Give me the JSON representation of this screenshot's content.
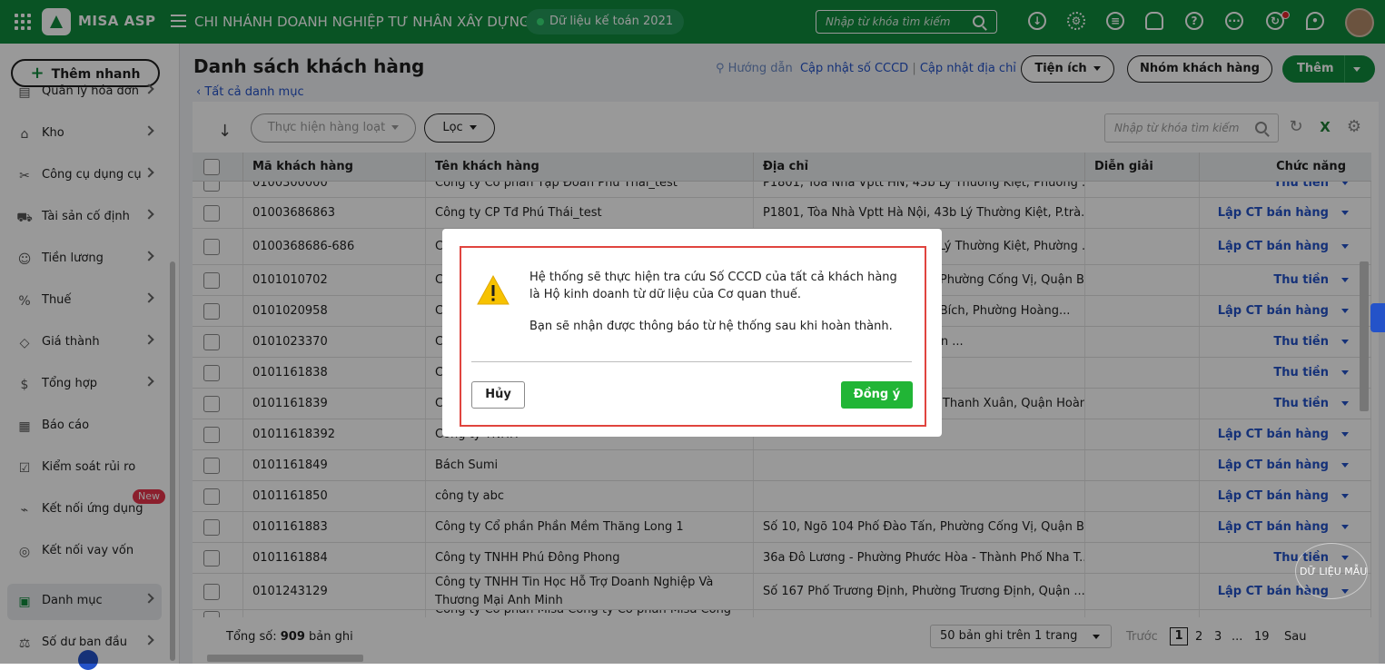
{
  "topbar": {
    "brand": "MISA ASP",
    "company": "CHI NHÁNH DOANH NGHIỆP TƯ NHÂN XÂY DỰNG ...",
    "database": "Dữ liệu kế toán 2021",
    "search_placeholder": "Nhập từ khóa tìm kiếm",
    "icons": [
      "download-icon",
      "gear-icon",
      "chat-icon",
      "bell-icon",
      "help-icon",
      "more-icon",
      "refresh-notify-icon",
      "location-icon"
    ]
  },
  "sidebar": {
    "quick_add": "Thêm nhanh",
    "items": [
      {
        "label": "Quản lý hóa đơn",
        "icon": "invoice-icon"
      },
      {
        "label": "Kho",
        "icon": "warehouse-icon"
      },
      {
        "label": "Công cụ dụng cụ",
        "icon": "tools-icon"
      },
      {
        "label": "Tài sản cố định",
        "icon": "asset-icon"
      },
      {
        "label": "Tiền lương",
        "icon": "salary-icon"
      },
      {
        "label": "Thuế",
        "icon": "tax-icon"
      },
      {
        "label": "Giá thành",
        "icon": "price-tag-icon"
      },
      {
        "label": "Tổng hợp",
        "icon": "summary-icon"
      },
      {
        "label": "Báo cáo",
        "icon": "report-icon"
      },
      {
        "label": "Kiểm soát rủi ro",
        "icon": "risk-icon"
      },
      {
        "label": "Kết nối ứng dụng",
        "icon": "plug-icon"
      },
      {
        "label": "Kết nối vay vốn",
        "icon": "loan-icon"
      },
      {
        "label": "Danh mục",
        "icon": "catalog-icon"
      },
      {
        "label": "Số dư ban đầu",
        "icon": "balance-icon"
      }
    ],
    "new_badge": "New"
  },
  "header": {
    "title": "Danh sách khách hàng",
    "back": "Tất cả danh mục",
    "guide": "Hướng dẫn",
    "update_cccd": "Cập nhật số CCCD",
    "update_address": "Cập nhật địa chỉ",
    "separator": "|",
    "utilities": "Tiện ích",
    "customer_group": "Nhóm khách hàng",
    "add": "Thêm"
  },
  "grid": {
    "batch": "Thực hiện hàng loạt",
    "filter": "Lọc",
    "search_placeholder": "Nhập từ khóa tìm kiếm",
    "columns": [
      "Mã khách hàng",
      "Tên khách hàng",
      "Địa chỉ",
      "Diễn giải",
      "Chức năng"
    ],
    "rows": [
      {
        "code": "0100300000",
        "name": "Công ty Cổ phần Tập Đoàn Phú Thái_test",
        "address": "P1801, Tòa Nhà Vptt HN, 43b Lý Thường Kiệt, Phường ...",
        "note": "",
        "action": "Thu tiền"
      },
      {
        "code": "01003686863",
        "name": "Công ty CP Tđ Phú Thái_test",
        "address": "P1801, Tòa Nhà Vptt Hà Nội, 43b Lý Thường Kiệt, P.trà...",
        "note": "",
        "action": "Lập CT bán hàng"
      },
      {
        "code": "0100368686-686",
        "name": "Công ty Cổ phần Tập Đoàn Phú Thái Việt Nam",
        "address": "P1801, Tòa Nhà Vptt HN, 43b Lý Thường Kiệt, Phường ...",
        "note": "",
        "action": "Lập CT bán hàng"
      },
      {
        "code": "0101010702",
        "name": "Công ty TNHH",
        "address": "Số 10, Ngõ 104 Phố Đào Tấn, Phường Cống Vị, Quận B...",
        "note": "",
        "action": "Thu tiền"
      },
      {
        "code": "0101020958",
        "name": "Công ty Cổ phần",
        "address": "Số 12, Ngõ 25 Phố Phạm Huy Bích, Phường Hoàng...",
        "note": "",
        "action": "Lập CT bán hàng"
      },
      {
        "code": "0101023370",
        "name": "Công ty TNHH",
        "address": "Thôn Đình, Xã Tân Triều, Huyện ...",
        "note": "",
        "action": "Thu tiền"
      },
      {
        "code": "0101161838",
        "name": "Công ty TNHH",
        "address": "",
        "note": "",
        "action": "Thu tiền"
      },
      {
        "code": "0101161839",
        "name": "Công ty Cổ phần",
        "address": "Số 5, Phố Hàng Bông, Phường Thanh Xuân, Quận Hoàn Kiế...",
        "note": "",
        "action": "Thu tiền"
      },
      {
        "code": "01011618392",
        "name": "Công ty TNHH",
        "address": "",
        "note": "",
        "action": "Lập CT bán hàng"
      },
      {
        "code": "0101161849",
        "name": "Bách Sumi",
        "address": "",
        "note": "",
        "action": "Lập CT bán hàng"
      },
      {
        "code": "0101161850",
        "name": "công ty abc",
        "address": "",
        "note": "",
        "action": "Lập CT bán hàng"
      },
      {
        "code": "0101161883",
        "name": "Công ty Cổ phần Phần Mềm Thăng Long 1",
        "address": "Số 10, Ngõ 104 Phố Đào Tấn, Phường Cống Vị, Quận B...",
        "note": "",
        "action": "Lập CT bán hàng"
      },
      {
        "code": "0101161884",
        "name": "Công ty TNHH Phú Đông Phong",
        "address": "36a Đô Lương - Phường Phước Hòa - Thành Phố Nha T...",
        "note": "",
        "action": "Thu tiền"
      },
      {
        "code": "0101243129",
        "name": "Công ty TNHH Tin Học Hỗ Trợ Doanh Nghiệp Và Thương Mại Anh Minh",
        "address": "Số 167 Phố Trương Định, Phường Trương Định, Quận ...",
        "note": "",
        "action": "Lập CT bán hàng"
      },
      {
        "code": "",
        "name": "Công ty Cổ phần Misa Công ty Cổ phần Misa Công ty",
        "address": "",
        "note": "",
        "action": ""
      }
    ],
    "total_prefix": "Tổng số:",
    "total_count": "909",
    "total_suffix": "bản ghi",
    "page_size": "50 bản ghi trên 1 trang",
    "prev": "Trước",
    "pages": [
      "1",
      "2",
      "3",
      "...",
      "19"
    ],
    "next": "Sau"
  },
  "watermark": "DỮ LIỆU MẪU",
  "dialog": {
    "message1": "Hệ thống sẽ thực hiện tra cứu Số CCCD của tất cả khách hàng là Hộ kinh doanh từ dữ liệu của Cơ quan thuế.",
    "message2": "Bạn sẽ nhận được thông báo từ hệ thống sau khi hoàn thành.",
    "cancel": "Hủy",
    "ok": "Đồng ý"
  },
  "colors": {
    "brand_green": "#0f8a3c",
    "link_blue": "#2453c9",
    "ok_green": "#21b536",
    "highlight_red": "#e0443e"
  }
}
